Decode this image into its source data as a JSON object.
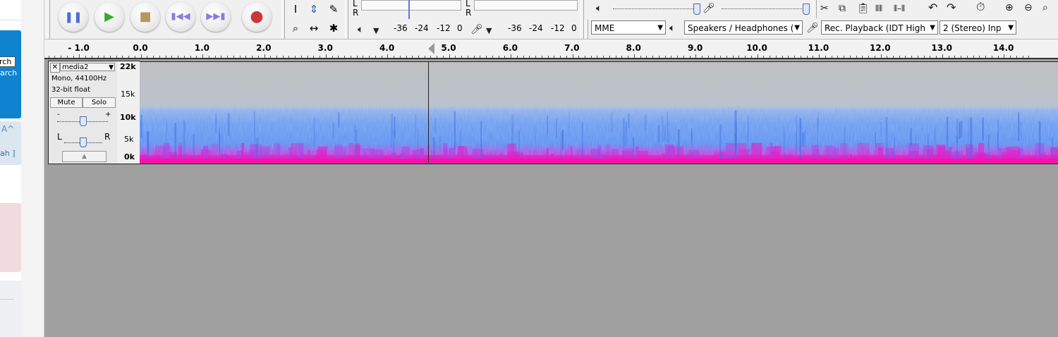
{
  "sidebar": {
    "search_box": "rch",
    "search_label": "arch",
    "caret": "A^",
    "bracket_label": "ah ]"
  },
  "transport": {
    "buttons": [
      {
        "name": "pause-button",
        "icon": "pause-icon",
        "glyph": "⏸"
      },
      {
        "name": "play-button",
        "icon": "play-icon",
        "glyph": "▶"
      },
      {
        "name": "stop-button",
        "icon": "stop-icon",
        "glyph": "■"
      },
      {
        "name": "skip-start-button",
        "icon": "skip-start-icon",
        "glyph": "⏮"
      },
      {
        "name": "skip-end-button",
        "icon": "skip-end-icon",
        "glyph": "⏭"
      },
      {
        "name": "record-button",
        "icon": "record-icon",
        "glyph": "●"
      }
    ]
  },
  "tools": {
    "selection": "I",
    "envelope": "⇕",
    "draw": "✎",
    "zoom": "🔍",
    "timeshift": "↔",
    "multi": "✱"
  },
  "meters": {
    "playback_lr_top": "L",
    "playback_lr_bottom": "R",
    "record_lr_top": "L",
    "record_lr_bottom": "R",
    "scale1": [
      "-36",
      "-24",
      "-12",
      "0"
    ],
    "scale2": [
      "-36",
      "-24",
      "-12",
      "0"
    ]
  },
  "devices": {
    "host": "MME",
    "output": "Speakers / Headphones (",
    "input": "Rec. Playback (IDT High",
    "channels": "2 (Stereo) Inp"
  },
  "ruler": {
    "ticks": [
      "- 1.0",
      "0.0",
      "1.0",
      "2.0",
      "3.0",
      "4.0",
      "5.0",
      "6.0",
      "7.0",
      "8.0",
      "9.0",
      "10.0",
      "11.0",
      "12.0",
      "13.0",
      "14.0"
    ]
  },
  "track": {
    "name": "media2",
    "close": "✕",
    "info1": "Mono, 44100Hz",
    "info2": "32-bit float",
    "mute": "Mute",
    "solo": "Solo",
    "gain_minus": "-",
    "gain_plus": "+",
    "pan_left": "L",
    "pan_right": "R",
    "collapse": "▲",
    "scale": [
      "22k",
      "15k",
      "10k",
      "5k",
      "0k"
    ]
  },
  "colors": {
    "spectrogram_bg": "#c0c0c0",
    "spectrum_blue": "#5a93f0",
    "spectrum_magenta": "#e020c8",
    "workspace": "#a0a0a0",
    "sidebar_blue": "#0f83cf"
  }
}
